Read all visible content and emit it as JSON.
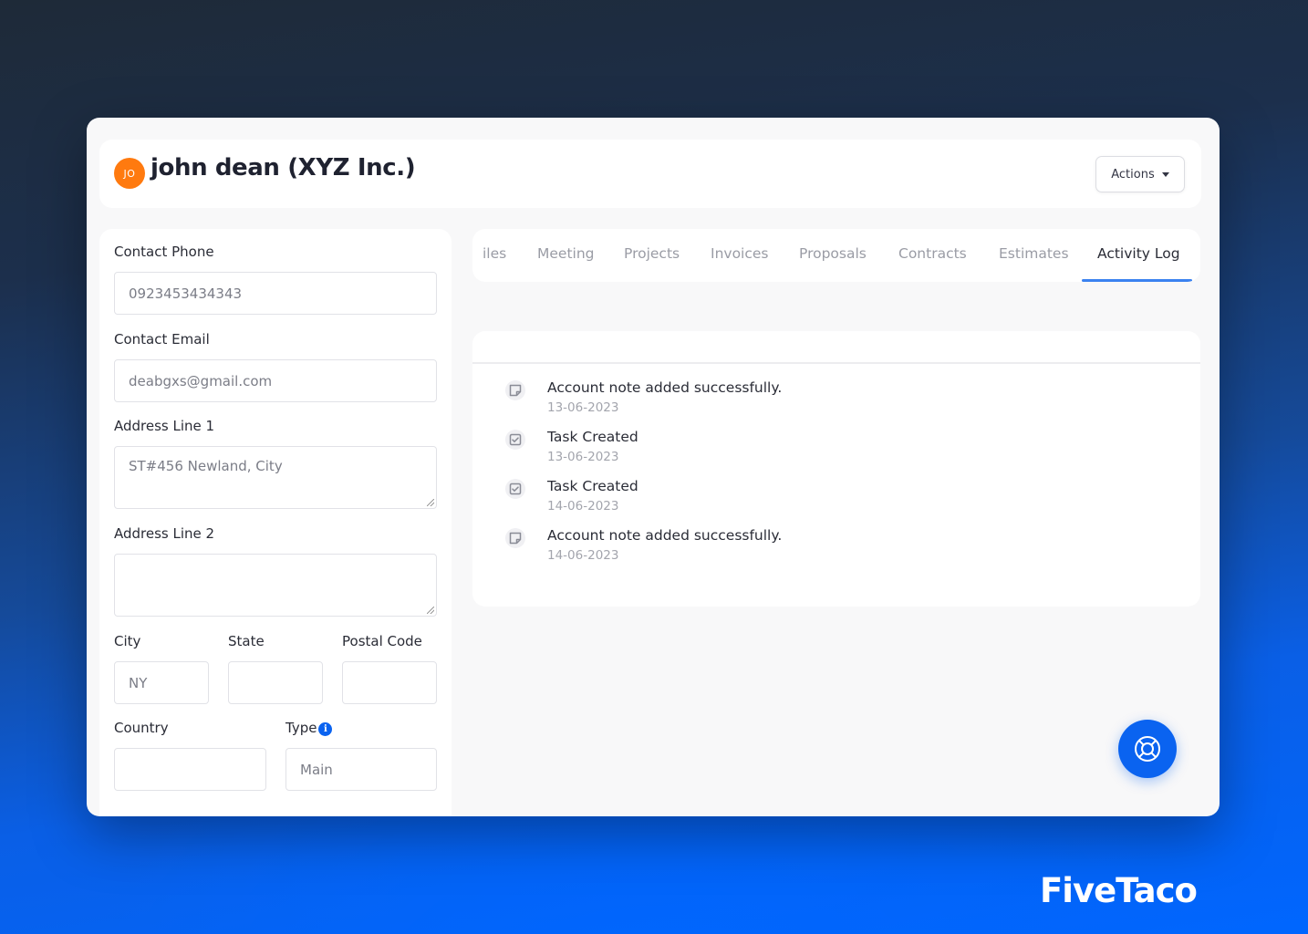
{
  "header": {
    "avatar_initials": "JO",
    "title": "john dean (XYZ Inc.)",
    "actions_label": "Actions"
  },
  "form": {
    "contact_phone": {
      "label": "Contact Phone",
      "value": "0923453434343"
    },
    "contact_email": {
      "label": "Contact Email",
      "value": "deabgxs@gmail.com"
    },
    "address_line_1": {
      "label": "Address Line 1",
      "value": "ST#456 Newland, City"
    },
    "address_line_2": {
      "label": "Address Line 2",
      "value": ""
    },
    "city": {
      "label": "City",
      "value": "NY"
    },
    "state": {
      "label": "State",
      "value": ""
    },
    "postal_code": {
      "label": "Postal Code",
      "value": ""
    },
    "country": {
      "label": "Country",
      "value": ""
    },
    "type": {
      "label": "Type",
      "value": "Main",
      "info_icon": "i"
    }
  },
  "tabs": [
    {
      "label": "iles"
    },
    {
      "label": "Meeting"
    },
    {
      "label": "Projects"
    },
    {
      "label": "Invoices"
    },
    {
      "label": "Proposals"
    },
    {
      "label": "Contracts"
    },
    {
      "label": "Estimates"
    },
    {
      "label": "Activity Log",
      "active": true
    }
  ],
  "activity_log": [
    {
      "icon": "note-icon",
      "title": "Account note added successfully.",
      "date": "13-06-2023"
    },
    {
      "icon": "checkbox-icon",
      "title": "Task Created",
      "date": "13-06-2023"
    },
    {
      "icon": "checkbox-icon",
      "title": "Task Created",
      "date": "14-06-2023"
    },
    {
      "icon": "note-icon",
      "title": "Account note added successfully.",
      "date": "14-06-2023"
    }
  ],
  "colors": {
    "accent": "#0a63f0",
    "avatar": "#ff7a0f",
    "tab_underline": "#3b82f0"
  },
  "brand": "FiveTaco"
}
